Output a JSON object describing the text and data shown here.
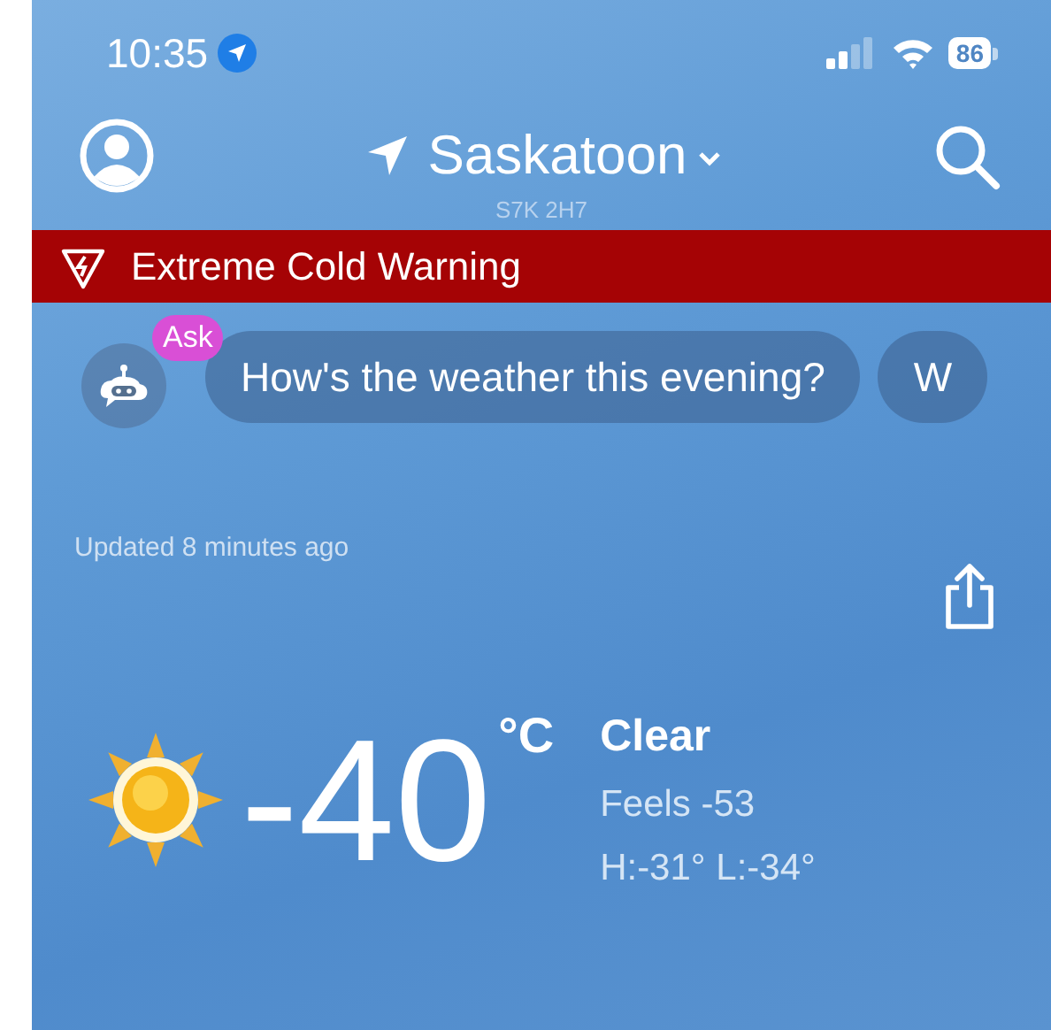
{
  "status_bar": {
    "time": "10:35",
    "location_active": true,
    "battery": "86"
  },
  "header": {
    "city": "Saskatoon",
    "postal_code": "S7K 2H7"
  },
  "alert": {
    "text": "Extreme Cold Warning"
  },
  "assistant": {
    "badge": "Ask",
    "chips": [
      "How's the weather this evening?",
      "W"
    ]
  },
  "updated": "Updated 8 minutes ago",
  "current": {
    "temperature": "-40",
    "unit": "°C",
    "condition": "Clear",
    "feels_like": "Feels -53",
    "high_low": "H:-31° L:-34°"
  }
}
